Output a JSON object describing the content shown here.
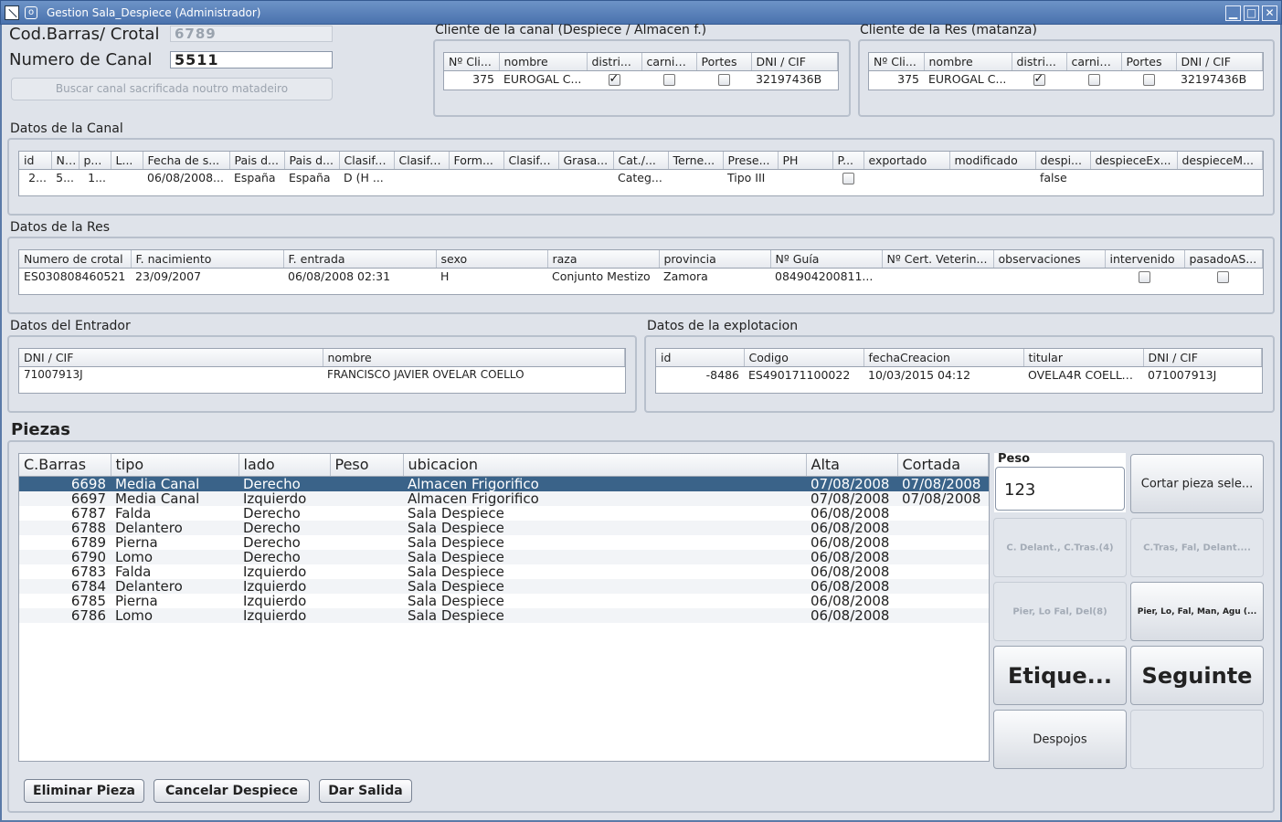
{
  "window": {
    "title": "Gestion Sala_Despiece (Administrador)",
    "minimize": "▁",
    "maximize": "□",
    "close": "✕"
  },
  "form": {
    "codbarras_label": "Cod.Barras/ Crotal",
    "codbarras_value": "6789",
    "canal_label": "Numero de Canal",
    "canal_value": "5511",
    "buscar_button": "Buscar canal sacrificada noutro matadeiro"
  },
  "cliente_canal": {
    "title": "Cliente de la canal (Despiece / Almacen f.)",
    "columns": [
      "Nº Cli...",
      "nombre",
      "distri...",
      "carnic...",
      "Portes",
      "DNI / CIF"
    ],
    "row": {
      "num": "375",
      "nombre": "EUROGAL C...",
      "distri": true,
      "carnic": false,
      "portes": false,
      "dni": "32197436B"
    }
  },
  "cliente_res": {
    "title": "Cliente de la Res (matanza)",
    "columns": [
      "Nº Cli...",
      "nombre",
      "distri...",
      "carnic...",
      "Portes",
      "DNI / CIF"
    ],
    "row": {
      "num": "375",
      "nombre": "EUROGAL C...",
      "distri": true,
      "carnic": false,
      "portes": false,
      "dni": "32197436B"
    }
  },
  "datos_canal": {
    "title": "Datos de la Canal",
    "columns": [
      "id",
      "N...",
      "p...",
      "L...",
      "Fecha de s...",
      "Pais d...",
      "Pais d...",
      "Clasif-...",
      "Clasif-...",
      "Form...",
      "Clasif-...",
      "Grasa...",
      "Cat./...",
      "Terne...",
      "Prese...",
      "PH",
      "P...",
      "exportado",
      "modificado",
      "despi...",
      "despieceEx...",
      "despieceM..."
    ],
    "row": [
      "2...",
      "5...",
      "1...",
      "",
      "06/08/2008...",
      "España",
      "España",
      "D (H ...",
      "",
      "",
      "",
      "",
      "Categ...",
      "",
      "Tipo III",
      "",
      "",
      "",
      "",
      "false",
      "",
      ""
    ]
  },
  "datos_res": {
    "title": "Datos de la Res",
    "columns": [
      "Numero de crotal",
      "F. nacimiento",
      "F. entrada",
      "sexo",
      "raza",
      "provincia",
      "Nº Guía",
      "Nº Cert. Veterin...",
      "observaciones",
      "intervenido",
      "pasadoAS..."
    ],
    "row": [
      "ES030808460521",
      "23/09/2007",
      "06/08/2008 02:31",
      "H",
      "Conjunto Mestizo",
      "Zamora",
      "084904200811...",
      "",
      "",
      "",
      ""
    ]
  },
  "datos_entrador": {
    "title": "Datos del Entrador",
    "columns": [
      "DNI / CIF",
      "nombre"
    ],
    "row": [
      "71007913J",
      "FRANCISCO JAVIER OVELAR COELLO"
    ]
  },
  "datos_explotacion": {
    "title": "Datos de la explotacion",
    "columns": [
      "id",
      "Codigo",
      "fechaCreacion",
      "titular",
      "DNI / CIF"
    ],
    "row": [
      "-8486",
      "ES490171100022",
      "10/03/2015 04:12",
      "OVELA4R COELLO ...",
      "071007913J"
    ]
  },
  "piezas": {
    "title": "Piezas",
    "columns": [
      "C.Barras",
      "tipo",
      "lado",
      "Peso",
      "ubicacion",
      "Alta",
      "Cortada"
    ],
    "rows": [
      [
        "6698",
        "Media Canal",
        "Derecho",
        "",
        "Almacen Frigorifico",
        "07/08/2008",
        "07/08/2008"
      ],
      [
        "6697",
        "Media Canal",
        "Izquierdo",
        "",
        "Almacen Frigorifico",
        "07/08/2008",
        "07/08/2008"
      ],
      [
        "6787",
        "Falda",
        "Derecho",
        "",
        "Sala Despiece",
        "06/08/2008",
        ""
      ],
      [
        "6788",
        "Delantero",
        "Derecho",
        "",
        "Sala Despiece",
        "06/08/2008",
        ""
      ],
      [
        "6789",
        "Pierna",
        "Derecho",
        "",
        "Sala Despiece",
        "06/08/2008",
        ""
      ],
      [
        "6790",
        "Lomo",
        "Derecho",
        "",
        "Sala Despiece",
        "06/08/2008",
        ""
      ],
      [
        "6783",
        "Falda",
        "Izquierdo",
        "",
        "Sala Despiece",
        "06/08/2008",
        ""
      ],
      [
        "6784",
        "Delantero",
        "Izquierdo",
        "",
        "Sala Despiece",
        "06/08/2008",
        ""
      ],
      [
        "6785",
        "Pierna",
        "Izquierdo",
        "",
        "Sala Despiece",
        "06/08/2008",
        ""
      ],
      [
        "6786",
        "Lomo",
        "Izquierdo",
        "",
        "Sala Despiece",
        "06/08/2008",
        ""
      ]
    ],
    "selected_row": 0
  },
  "side": {
    "peso_label": "Peso",
    "peso_value": "123",
    "cortar": "Cortar pieza sele...",
    "btn_cdelant": "C. Delant., C.Tras.(4)",
    "btn_ctras": "C.Tras, Fal, Delant....",
    "btn_pier_lo": "Pier, Lo Fal, Del(8)",
    "btn_pier_man": "Pier, Lo, Fal, Man, Agu (...",
    "etiquetar": "Etique...",
    "seguinte": "Seguinte",
    "despojos": "Despojos"
  },
  "bottom": {
    "eliminar": "Eliminar Pieza",
    "cancelar": "Cancelar Despiece",
    "dar_salida": "Dar Salida"
  },
  "colors": {
    "selection": "#3a6389",
    "titlebar": "#4a72ad"
  }
}
